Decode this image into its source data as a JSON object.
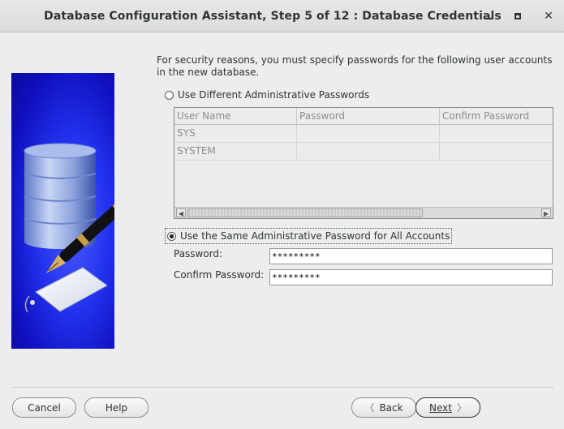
{
  "window": {
    "title": "Database Configuration Assistant, Step 5 of 12 : Database Credentials"
  },
  "intro_text": "For security reasons, you must specify passwords for the following user accounts in the new database.",
  "options": {
    "different": {
      "label": "Use Different Administrative Passwords",
      "selected": false
    },
    "same": {
      "label": "Use the Same Administrative Password for All Accounts",
      "selected": true
    }
  },
  "table": {
    "columns": [
      "User Name",
      "Password",
      "Confirm Password"
    ],
    "rows": [
      [
        "SYS",
        "",
        ""
      ],
      [
        "SYSTEM",
        "",
        ""
      ]
    ]
  },
  "form": {
    "password_label": "Password:",
    "password_value": "*********",
    "confirm_label": "Confirm Password:",
    "confirm_value": "*********"
  },
  "buttons": {
    "cancel": "Cancel",
    "help": "Help",
    "back": "Back",
    "next": "Next"
  }
}
